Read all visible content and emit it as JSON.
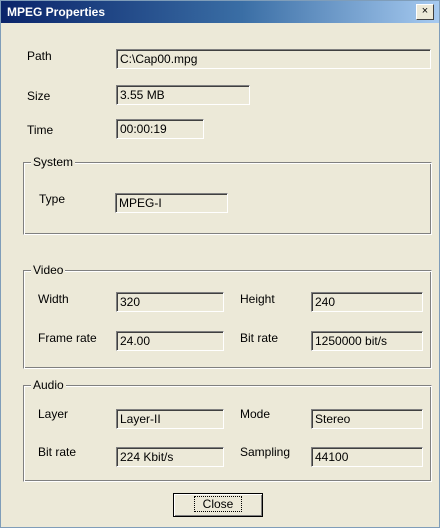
{
  "window": {
    "title": "MPEG Properties",
    "close_glyph": "×"
  },
  "file": {
    "path_label": "Path",
    "path_value": "C:\\Cap00.mpg",
    "size_label": "Size",
    "size_value": "3.55 MB",
    "time_label": "Time",
    "time_value": "00:00:19"
  },
  "system": {
    "group_title": "System",
    "type_label": "Type",
    "type_value": "MPEG-I"
  },
  "video": {
    "group_title": "Video",
    "width_label": "Width",
    "width_value": "320",
    "height_label": "Height",
    "height_value": "240",
    "framerate_label": "Frame rate",
    "framerate_value": "24.00",
    "bitrate_label": "Bit rate",
    "bitrate_value": "1250000 bit/s"
  },
  "audio": {
    "group_title": "Audio",
    "layer_label": "Layer",
    "layer_value": "Layer-II",
    "mode_label": "Mode",
    "mode_value": "Stereo",
    "bitrate_label": "Bit rate",
    "bitrate_value": "224 Kbit/s",
    "sampling_label": "Sampling",
    "sampling_value": "44100"
  },
  "buttons": {
    "close_label": "Close"
  }
}
